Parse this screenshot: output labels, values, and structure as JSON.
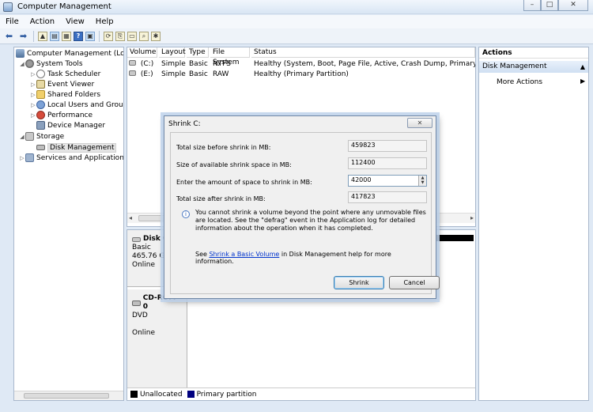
{
  "window": {
    "title": "Computer Management",
    "minimize": "–",
    "maximize": "□",
    "close": "✕"
  },
  "menu": [
    "File",
    "Action",
    "View",
    "Help"
  ],
  "toolbar": [
    "back-arrow-icon",
    "forward-arrow-icon",
    "up-folder-icon",
    "show-hide-tree-icon",
    "help-icon",
    "properties-icon",
    "refresh-icon",
    "export-icon",
    "open-icon",
    "find-icon",
    "settings-icon"
  ],
  "tree": {
    "root": "Computer Management (Local",
    "items": [
      {
        "label": "System Tools",
        "icon": "tools-icon"
      },
      {
        "label": "Task Scheduler",
        "icon": "clock-icon"
      },
      {
        "label": "Event Viewer",
        "icon": "event-viewer-icon"
      },
      {
        "label": "Shared Folders",
        "icon": "shared-folder-icon"
      },
      {
        "label": "Local Users and Groups",
        "icon": "users-icon"
      },
      {
        "label": "Performance",
        "icon": "performance-icon"
      },
      {
        "label": "Device Manager",
        "icon": "device-manager-icon"
      },
      {
        "label": "Storage",
        "icon": "storage-icon"
      },
      {
        "label": "Disk Management",
        "icon": "disk-icon"
      },
      {
        "label": "Services and Applications",
        "icon": "services-icon"
      }
    ]
  },
  "volumes": {
    "headers": [
      "Volume",
      "Layout",
      "Type",
      "File System",
      "Status"
    ],
    "rows": [
      [
        "(C:)",
        "Simple",
        "Basic",
        "NTFS",
        "Healthy (System, Boot, Page File, Active, Crash Dump, Primary Partition"
      ],
      [
        "(E:)",
        "Simple",
        "Basic",
        "RAW",
        "Healthy (Primary Partition)"
      ]
    ]
  },
  "disks": [
    {
      "name": "Disk 0",
      "type": "Basic",
      "size": "465.76 GB",
      "status": "Online"
    },
    {
      "name": "CD-ROM 0",
      "type": "DVD",
      "status": "Online"
    }
  ],
  "legend": [
    {
      "label": "Unallocated",
      "color": "#000000"
    },
    {
      "label": "Primary partition",
      "color": "#00007f"
    }
  ],
  "actions": {
    "header": "Actions",
    "section": "Disk Management",
    "item": "More Actions"
  },
  "dialog": {
    "title": "Shrink C:",
    "close": "✕",
    "fields": [
      {
        "label": "Total size before shrink in MB:",
        "value": "459823"
      },
      {
        "label": "Size of available shrink space in MB:",
        "value": "112400"
      },
      {
        "label": "Enter the amount of space to shrink in MB:",
        "value": "42000"
      },
      {
        "label": "Total size after shrink in MB:",
        "value": "417823"
      }
    ],
    "info": "You cannot shrink a volume beyond the point where any unmovable files are located. See the \"defrag\" event in the Application log for detailed information about the operation when it has completed.",
    "see_prefix": "See ",
    "see_link": "Shrink a Basic Volume",
    "see_suffix": " in Disk Management help for more information.",
    "shrink_button": "Shrink",
    "cancel_button": "Cancel"
  }
}
